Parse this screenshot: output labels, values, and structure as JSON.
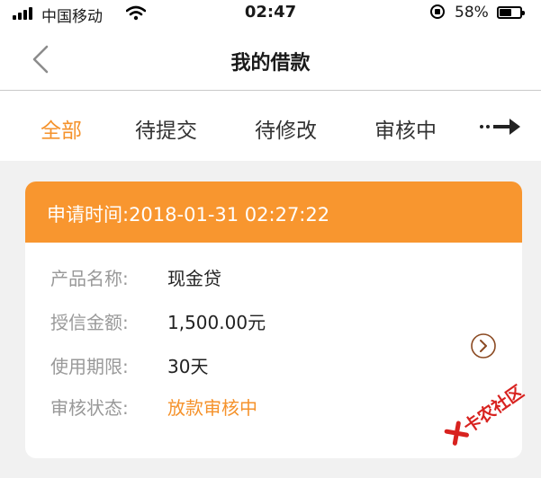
{
  "status_bar": {
    "carrier": "中国移动",
    "time": "02:47",
    "battery": "58%",
    "battery_level": 0.58
  },
  "header": {
    "title": "我的借款"
  },
  "tabs": [
    {
      "label": "全部",
      "active": true
    },
    {
      "label": "待提交",
      "active": false
    },
    {
      "label": "待修改",
      "active": false
    },
    {
      "label": "审核中",
      "active": false
    }
  ],
  "loan": {
    "apply_time": "申请时间:2018-01-31 02:27:22",
    "fields": [
      {
        "label": "产品名称:",
        "value": "现金贷"
      },
      {
        "label": "授信金额:",
        "value": "1,500.00元"
      },
      {
        "label": "使用期限:",
        "value": "30天"
      },
      {
        "label": "审核状态:",
        "value": "放款审核中"
      }
    ]
  },
  "watermark": {
    "text": "卡农社区"
  },
  "colors": {
    "accent": "#f5922b",
    "card_header": "#f8962f",
    "watermark": "#d8221f"
  }
}
